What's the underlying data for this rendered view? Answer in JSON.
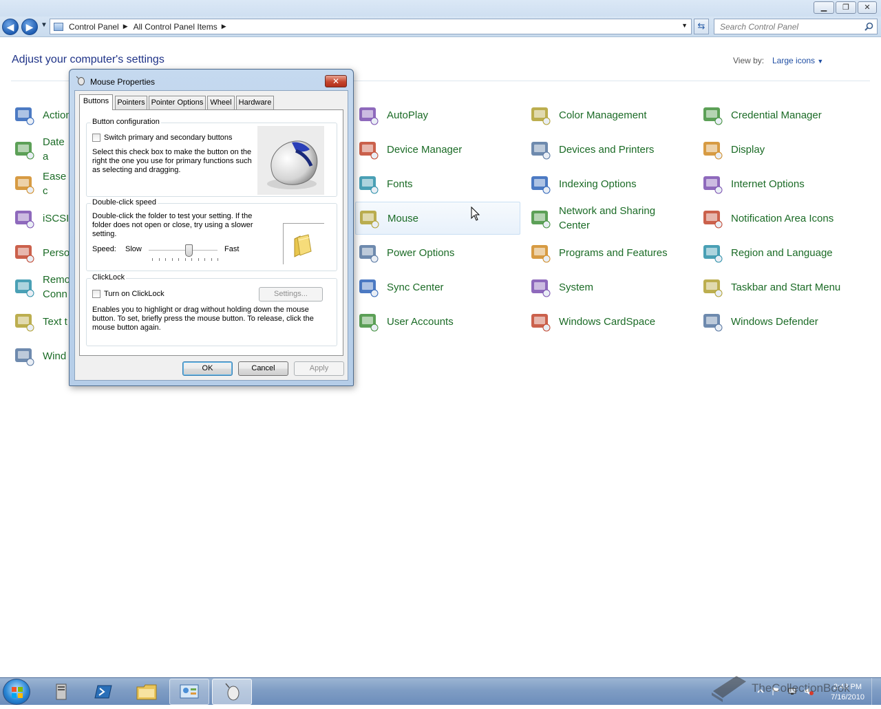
{
  "explorer": {
    "breadcrumbs": [
      "Control Panel",
      "All Control Panel Items"
    ],
    "search_placeholder": "Search Control Panel",
    "page_title": "Adjust your computer's settings",
    "view_by_label": "View by:",
    "view_by_value": "Large icons"
  },
  "items": {
    "col1": [
      "Action",
      "Date a",
      "Ease c",
      "iSCSI",
      "Perso",
      "Remo",
      "Text t",
      "Wind"
    ],
    "col1_line2": [
      "",
      "",
      "",
      "",
      "",
      "Conn",
      "",
      ""
    ],
    "col2": [
      "AutoPlay",
      "Device Manager",
      "Fonts",
      "Mouse",
      "Power Options",
      "Sync Center",
      "User Accounts"
    ],
    "col3": [
      "Color Management",
      "Devices and Printers",
      "Indexing Options",
      "Network and Sharing",
      "Programs and Features",
      "System",
      "Windows CardSpace"
    ],
    "col3_line2": [
      "",
      "",
      "",
      "Center",
      "",
      "",
      ""
    ],
    "col4": [
      "Credential Manager",
      "Display",
      "Internet Options",
      "Notification Area Icons",
      "Region and Language",
      "Taskbar and Start Menu",
      "Windows Defender"
    ]
  },
  "dialog": {
    "title": "Mouse Properties",
    "close": "✕",
    "tabs": [
      "Buttons",
      "Pointers",
      "Pointer Options",
      "Wheel",
      "Hardware"
    ],
    "button_config": {
      "legend": "Button configuration",
      "checkbox_label": "Switch primary and secondary buttons",
      "desc1": "Select this check box to make the button on the",
      "desc2": "right the one you use for primary functions such",
      "desc3": "as selecting and dragging."
    },
    "double_click": {
      "legend": "Double-click speed",
      "desc1": "Double-click the folder to test your setting. If the",
      "desc2": "folder does not open or close, try using a slower",
      "desc3": "setting.",
      "speed_label": "Speed:",
      "slow": "Slow",
      "fast": "Fast",
      "speed_fraction": 0.6
    },
    "clicklock": {
      "legend": "ClickLock",
      "checkbox_label": "Turn on ClickLock",
      "settings_button": "Settings...",
      "desc1": "Enables you to highlight or drag without holding down the mouse",
      "desc2": "button. To set, briefly press the mouse button. To release, click the",
      "desc3": "mouse button again."
    },
    "ok": "OK",
    "cancel": "Cancel",
    "apply": "Apply"
  },
  "taskbar": {
    "time": "2:43 PM",
    "date": "7/16/2010"
  },
  "watermark": "TheCollectionBook"
}
